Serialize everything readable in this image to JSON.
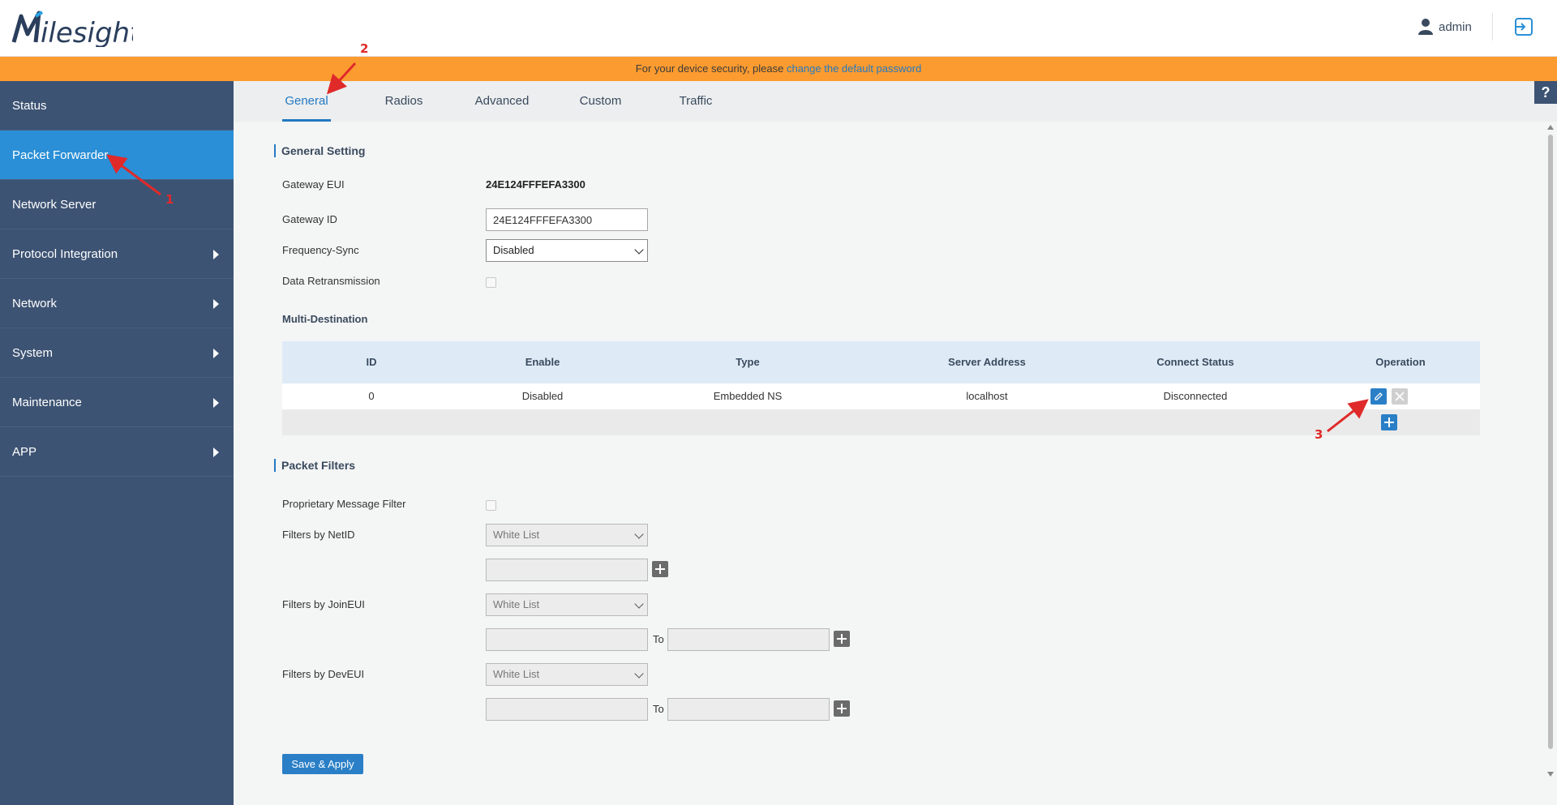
{
  "header": {
    "logo_text": "Milesight",
    "user_label": "admin",
    "user_icon": "user-icon",
    "logout_icon": "logout-icon"
  },
  "banner": {
    "text": "For your device security, please ",
    "link_text": "change the default password"
  },
  "sidebar": {
    "items": [
      {
        "label": "Status",
        "has_arrow": false,
        "active": false
      },
      {
        "label": "Packet Forwarder",
        "has_arrow": false,
        "active": true
      },
      {
        "label": "Network Server",
        "has_arrow": false,
        "active": false
      },
      {
        "label": "Protocol Integration",
        "has_arrow": true,
        "active": false
      },
      {
        "label": "Network",
        "has_arrow": true,
        "active": false
      },
      {
        "label": "System",
        "has_arrow": true,
        "active": false
      },
      {
        "label": "Maintenance",
        "has_arrow": true,
        "active": false
      },
      {
        "label": "APP",
        "has_arrow": true,
        "active": false
      }
    ]
  },
  "tabs": [
    "General",
    "Radios",
    "Advanced",
    "Custom",
    "Traffic"
  ],
  "active_tab": "General",
  "help_label": "?",
  "general_setting": {
    "title": "General Setting",
    "gateway_eui_label": "Gateway EUI",
    "gateway_eui_value": "24E124FFFEFA3300",
    "gateway_id_label": "Gateway ID",
    "gateway_id_value": "24E124FFFEFA3300",
    "frequency_sync_label": "Frequency-Sync",
    "frequency_sync_value": "Disabled",
    "data_retransmission_label": "Data Retransmission",
    "data_retransmission_checked": false
  },
  "multi_destination": {
    "title": "Multi-Destination",
    "columns": [
      "ID",
      "Enable",
      "Type",
      "Server Address",
      "Connect Status",
      "Operation"
    ],
    "rows": [
      {
        "id": "0",
        "enable": "Disabled",
        "type": "Embedded NS",
        "server_address": "localhost",
        "connect_status": "Disconnected"
      }
    ]
  },
  "packet_filters": {
    "title": "Packet Filters",
    "proprietary_label": "Proprietary Message Filter",
    "netid_label": "Filters by NetID",
    "netid_mode": "White List",
    "joineui_label": "Filters by JoinEUI",
    "joineui_mode": "White List",
    "deveui_label": "Filters by DevEUI",
    "deveui_mode": "White List",
    "to_label": "To"
  },
  "save_button": "Save & Apply",
  "annotations": [
    "1",
    "2",
    "3"
  ],
  "colors": {
    "sidebar_bg": "#3d5373",
    "active_item": "#2a8fd6",
    "banner": "#fc9b2f",
    "accent": "#2379c2",
    "table_header": "#deebf7",
    "annotation": "#e02a2a"
  }
}
